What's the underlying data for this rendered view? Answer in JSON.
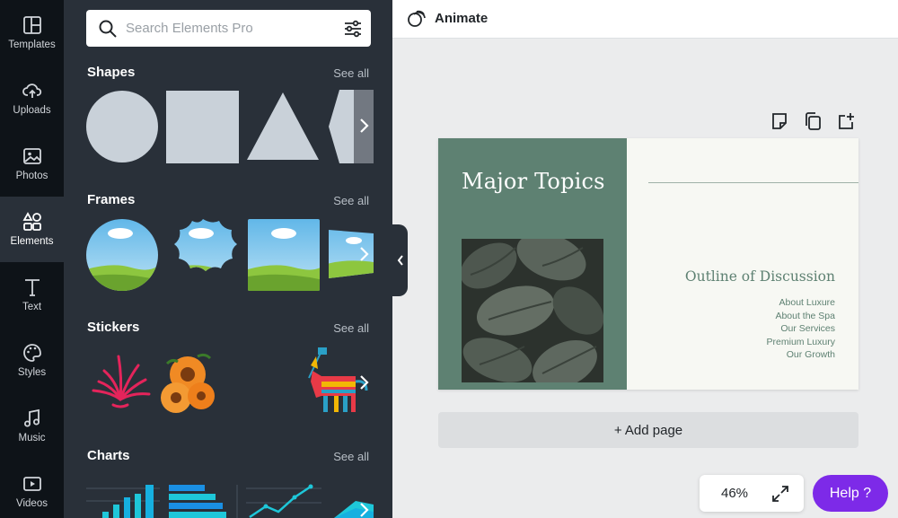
{
  "rail": {
    "items": [
      {
        "label": "Templates",
        "icon": "templates-icon"
      },
      {
        "label": "Uploads",
        "icon": "upload-icon"
      },
      {
        "label": "Photos",
        "icon": "photo-icon"
      },
      {
        "label": "Elements",
        "icon": "elements-icon",
        "active": true
      },
      {
        "label": "Text",
        "icon": "text-icon"
      },
      {
        "label": "Styles",
        "icon": "palette-icon"
      },
      {
        "label": "Music",
        "icon": "music-icon"
      },
      {
        "label": "Videos",
        "icon": "video-icon"
      }
    ]
  },
  "search": {
    "placeholder": "Search Elements Pro"
  },
  "sections": {
    "shapes": {
      "title": "Shapes",
      "see_all": "See all"
    },
    "frames": {
      "title": "Frames",
      "see_all": "See all"
    },
    "stickers": {
      "title": "Stickers",
      "see_all": "See all"
    },
    "charts": {
      "title": "Charts",
      "see_all": "See all"
    }
  },
  "topbar": {
    "animate_label": "Animate"
  },
  "slide": {
    "title": "Major Topics",
    "subtitle": "Outline of Discussion",
    "items": [
      "About Luxure",
      "About the Spa",
      "Our Services",
      "Premium Luxury",
      "Our Growth"
    ]
  },
  "add_page_label": "+ Add page",
  "zoom": {
    "value": "46%"
  },
  "help": {
    "label": "Help ?"
  },
  "colors": {
    "rail_bg": "#0e1318",
    "panel_bg": "#293039",
    "slide_green": "#5e8172",
    "slide_bg": "#f7f8f3",
    "help_purple": "#7d2ae8",
    "shape_gray": "#c9d1d9"
  }
}
